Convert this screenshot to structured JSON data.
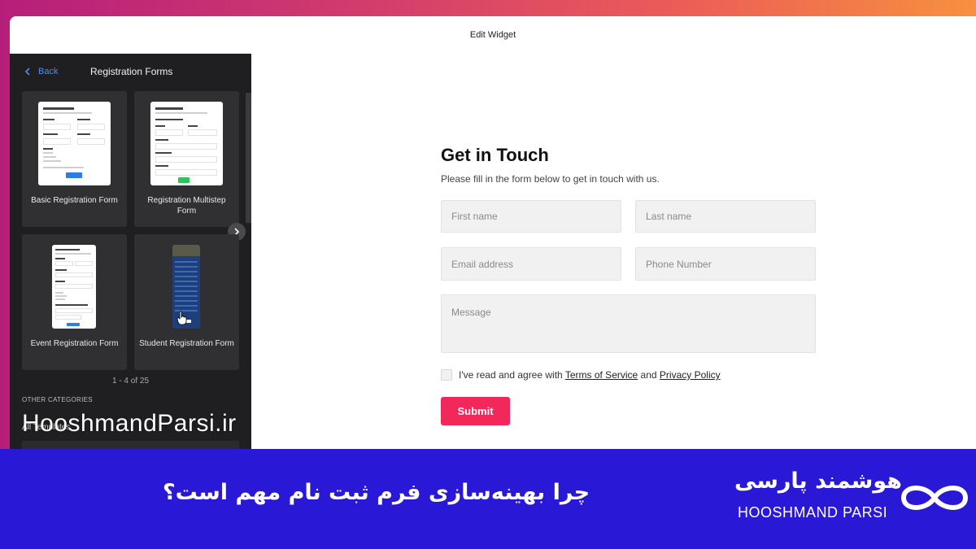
{
  "window": {
    "title": "Edit Widget"
  },
  "sidebar": {
    "back_label": "Back",
    "title": "Registration Forms",
    "templates": [
      {
        "label": "Basic Registration Form"
      },
      {
        "label": "Registration Multistep Form"
      },
      {
        "label": "Event Registration Form"
      },
      {
        "label": "Student Registration Form"
      }
    ],
    "pager": "1 - 4 of 25",
    "other_heading": "OTHER CATEGORIES",
    "all_templates": "All Templates"
  },
  "form": {
    "title": "Get in Touch",
    "subtitle": "Please fill in the form below to get in touch with us.",
    "first_name_placeholder": "First name",
    "last_name_placeholder": "Last name",
    "email_placeholder": "Email address",
    "phone_placeholder": "Phone Number",
    "message_placeholder": "Message",
    "agree_prefix": "I've read and agree with",
    "terms_link": "Terms of Service",
    "agree_and": "and",
    "privacy_link": "Privacy Policy",
    "submit_label": "Submit"
  },
  "watermark": "HooshmandParsi.ir",
  "banner": {
    "question": "چرا بهینه‌سازی فرم ثبت نام مهم است؟",
    "brand_fa": "هوشمند پارسی",
    "brand_en": "HOOSHMAND PARSI"
  },
  "colors": {
    "accent_submit": "#f2285b",
    "link_blue": "#4c8ff0",
    "banner_bg": "#2a18d7",
    "sidebar_bg": "#1f1f21"
  }
}
